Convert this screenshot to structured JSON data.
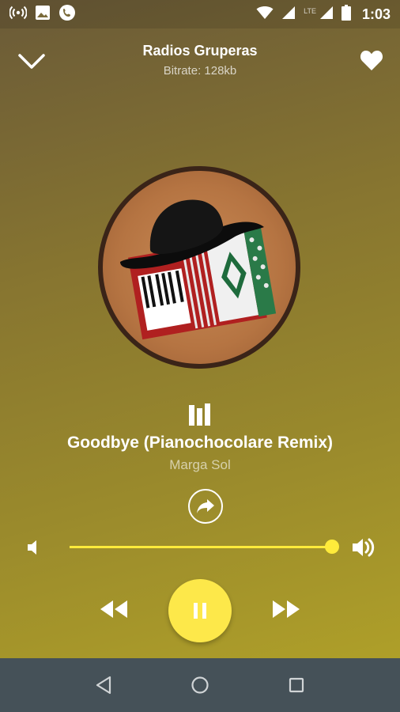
{
  "status_bar": {
    "time": "1:03",
    "network_label": "LTE",
    "icons": [
      "radio-broadcast-icon",
      "image-icon",
      "phone-icon",
      "wifi-icon",
      "signal-icon",
      "signal-icon",
      "battery-icon"
    ]
  },
  "header": {
    "station_name": "Radios Gruperas",
    "bitrate": "Bitrate: 128kb",
    "collapse_icon": "chevron-down-icon",
    "favorite_icon": "heart-icon"
  },
  "now_playing": {
    "song_title": "Goodbye (Pianochocolare Remix)",
    "artist": "Marga Sol",
    "artwork": "cowboy-hat-accordion-artwork"
  },
  "volume": {
    "level": 1.0,
    "low_icon": "volume-low-icon",
    "high_icon": "volume-high-icon"
  },
  "controls": {
    "rewind_icon": "rewind-icon",
    "pause_icon": "pause-icon",
    "forward_icon": "fast-forward-icon",
    "share_icon": "share-icon"
  },
  "nav_bar": {
    "icons": [
      "back-triangle-icon",
      "home-circle-icon",
      "recents-square-icon"
    ]
  },
  "colors": {
    "accent": "#fde84a",
    "slider": "#ffeb3b",
    "nav_bar": "#455158",
    "artwork_border": "#3a2418"
  }
}
